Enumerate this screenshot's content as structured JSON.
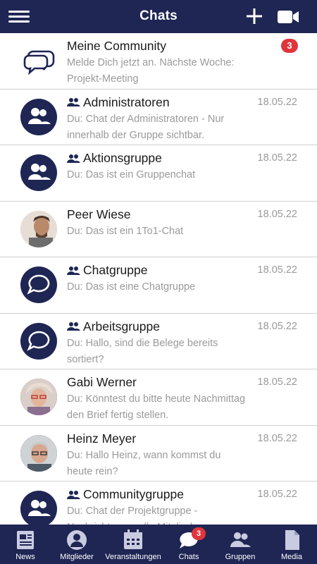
{
  "colors": {
    "bar": "#1f2654",
    "badge": "#e0353b",
    "muted": "#9a9a9a"
  },
  "header": {
    "title": "Chats",
    "menu_icon": "hamburger-icon",
    "add_icon": "plus-icon",
    "video_icon": "video-camera-icon"
  },
  "chats": [
    {
      "name": "Meine Community",
      "group": false,
      "preview": "Melde Dich jetzt an. Nächste Woche: Projekt-Meeting",
      "date": "",
      "badge": "3",
      "avatar": "speech-bubbles-logo"
    },
    {
      "name": "Administratoren",
      "group": true,
      "preview": "Du: Chat der Administratoren - Nur innerhalb der Gruppe sichtbar.",
      "date": "18.05.22",
      "badge": "",
      "avatar": "group-icon"
    },
    {
      "name": "Aktionsgruppe",
      "group": true,
      "preview": "Du: Das ist ein Gruppenchat",
      "date": "18.05.22",
      "badge": "",
      "avatar": "group-icon"
    },
    {
      "name": "Peer Wiese",
      "group": false,
      "preview": "Du: Das ist ein 1To1-Chat",
      "date": "18.05.22",
      "badge": "",
      "avatar": "person-photo"
    },
    {
      "name": "Chatgruppe",
      "group": true,
      "preview": "Du: Das ist eine Chatgruppe",
      "date": "18.05.22",
      "badge": "",
      "avatar": "chat-bubble-icon"
    },
    {
      "name": "Arbeitsgruppe",
      "group": true,
      "preview": "Du: Hallo, sind die Belege bereits sortiert?",
      "date": "18.05.22",
      "badge": "",
      "avatar": "chat-bubble-icon"
    },
    {
      "name": "Gabi Werner",
      "group": false,
      "preview": "Du: Könntest du bitte heute Nachmittag den Brief fertig stellen.",
      "date": "18.05.22",
      "badge": "",
      "avatar": "person-photo"
    },
    {
      "name": "Heinz Meyer",
      "group": false,
      "preview": "Du: Hallo Heinz, wann kommst du heute rein?",
      "date": "18.05.22",
      "badge": "",
      "avatar": "person-photo"
    },
    {
      "name": "Communitygruppe",
      "group": true,
      "preview": "Du: Chat der Projektgruppe - Nachrichten an alle Mitglieder",
      "date": "18.05.22",
      "badge": "",
      "avatar": "group-icon"
    }
  ],
  "tabs": [
    {
      "label": "News",
      "icon": "newspaper-icon",
      "badge": ""
    },
    {
      "label": "Mitglieder",
      "icon": "member-icon",
      "badge": ""
    },
    {
      "label": "Veranstaltungen",
      "icon": "calendar-icon",
      "badge": ""
    },
    {
      "label": "Chats",
      "icon": "chat-bubble-icon",
      "badge": "3",
      "active": true
    },
    {
      "label": "Gruppen",
      "icon": "group-icon",
      "badge": ""
    },
    {
      "label": "Media",
      "icon": "document-icon",
      "badge": ""
    }
  ]
}
